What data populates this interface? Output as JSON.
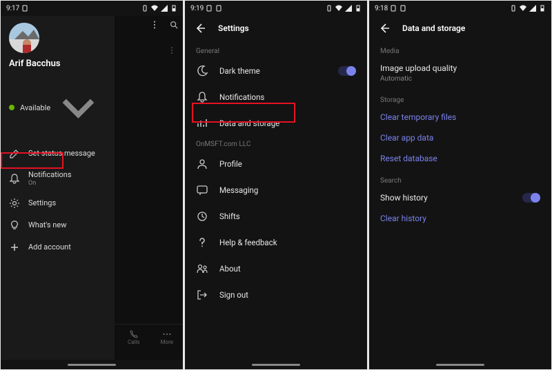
{
  "screen1": {
    "status": {
      "time": "9:17"
    },
    "user_name": "Arif Bacchus",
    "presence": {
      "label": "Available"
    },
    "items": {
      "set_status": "Set status message",
      "notifications": "Notifications",
      "notifications_sub": "On",
      "settings": "Settings",
      "whats_new": "What's new",
      "add_account": "Add account"
    },
    "bottom": {
      "calls": "Calls",
      "more": "More"
    }
  },
  "screen2": {
    "status": {
      "time": "9:19"
    },
    "title": "Settings",
    "sections": {
      "general": "General",
      "org": "OnMSFT.com LLC"
    },
    "items": {
      "dark_theme": "Dark theme",
      "notifications": "Notifications",
      "data_storage": "Data and storage",
      "profile": "Profile",
      "messaging": "Messaging",
      "shifts": "Shifts",
      "help": "Help & feedback",
      "about": "About",
      "sign_out": "Sign out"
    }
  },
  "screen3": {
    "status": {
      "time": "9:18"
    },
    "title": "Data and storage",
    "sections": {
      "media": "Media",
      "storage": "Storage",
      "search": "Search"
    },
    "items": {
      "upload_quality": "Image upload quality",
      "upload_quality_sub": "Automatic",
      "clear_temp": "Clear temporary files",
      "clear_app": "Clear app data",
      "reset_db": "Reset database",
      "show_history": "Show history",
      "clear_history": "Clear history"
    }
  }
}
